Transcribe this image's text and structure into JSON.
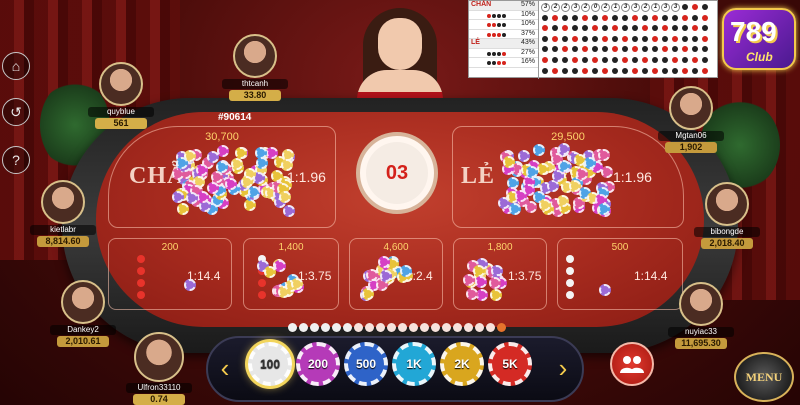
{
  "game": {
    "table_id": "#90614",
    "round": "03"
  },
  "bets": {
    "even": {
      "label": "CHẴN",
      "amount": "30,700",
      "payout": "1:1.96"
    },
    "odd": {
      "label": "LẺ",
      "amount": "29,500",
      "payout": "1:1.96"
    },
    "small": [
      {
        "amount": "200",
        "payout": "1:14.4"
      },
      {
        "amount": "1,400",
        "payout": "1:3.75"
      },
      {
        "amount": "4,600",
        "payout": "1:2.4"
      },
      {
        "amount": "1,800",
        "payout": "1:3.75"
      },
      {
        "amount": "500",
        "payout": "1:14.4"
      }
    ]
  },
  "players": [
    {
      "name": "quyblue",
      "balance": "561"
    },
    {
      "name": "thtcanh",
      "balance": "33.80"
    },
    {
      "name": "kietlabr",
      "balance": "8,814.60"
    },
    {
      "name": "Dankey2",
      "balance": "2,010.61"
    },
    {
      "name": "Ulfron33110",
      "balance": "0.74"
    },
    {
      "name": "Mgtan06",
      "balance": "1,902"
    },
    {
      "name": "bibongde",
      "balance": "2,018.40"
    },
    {
      "name": "nuyiac33",
      "balance": "11,695.30"
    }
  ],
  "history": {
    "stats": [
      {
        "label": "CHẴN",
        "pct": "57%"
      },
      {
        "label": "",
        "pct": "10%"
      },
      {
        "label": "",
        "pct": "10%"
      },
      {
        "label": "",
        "pct": "37%"
      },
      {
        "label": "LẺ",
        "pct": "43%"
      },
      {
        "label": "",
        "pct": "27%"
      },
      {
        "label": "",
        "pct": "16%"
      }
    ],
    "grid_numbers": [
      "3",
      "2",
      "2",
      "3",
      "2",
      "0",
      "2",
      "1",
      "3",
      "3",
      "2",
      "1",
      "3",
      "3"
    ]
  },
  "chips": [
    {
      "label": "100",
      "color": "#e7e7e7",
      "text": "#333"
    },
    {
      "label": "200",
      "color": "#b53ab8",
      "text": "#fff"
    },
    {
      "label": "500",
      "color": "#2e63c8",
      "text": "#fff"
    },
    {
      "label": "1K",
      "color": "#22a7d6",
      "text": "#fff"
    },
    {
      "label": "2K",
      "color": "#d9a61e",
      "text": "#fff"
    },
    {
      "label": "5K",
      "color": "#d42a24",
      "text": "#fff"
    }
  ],
  "logo": {
    "big": "789",
    "small": "Club"
  },
  "menu_label": "MENU",
  "colors": {
    "felt": "#b3301f",
    "accent_gold": "#f2c94c",
    "chip_pink": "#d63fc4",
    "chip_yellow": "#e8c33a"
  }
}
